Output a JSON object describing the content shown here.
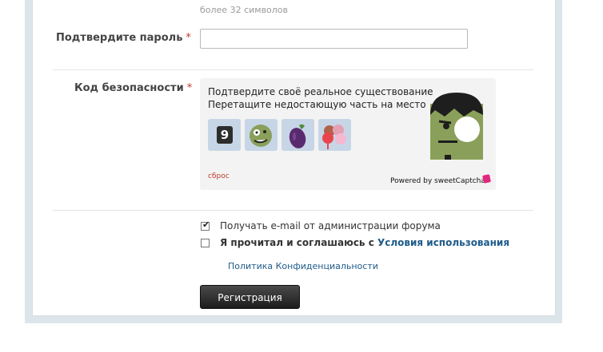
{
  "form": {
    "password_hint": "более 32 символов",
    "confirm_password_label": "Подтвердите пароль",
    "required_mark": "*",
    "security_code_label": "Код безопасности"
  },
  "captcha": {
    "line1": "Подтвердите своё реальное существование",
    "line2": "Перетащите недостающую часть на место",
    "tiles": [
      "number-nine-tile",
      "zombie-face-tile",
      "eggplant-tile",
      "ice-cream-tile"
    ],
    "tile_nine_text": "9",
    "reset_label": "сброс",
    "powered_by": "Powered by sweetCaptcha"
  },
  "options": {
    "email_label": "Получать e-mail от администрации форума",
    "email_checked": true,
    "agree_prefix": "Я прочитал и соглашаюсь с",
    "agree_link": "Условия использования",
    "agree_checked": false,
    "privacy_link": "Политика Конфиденциальности"
  },
  "submit": {
    "label": "Регистрация"
  },
  "colors": {
    "required": "#c0392b",
    "link": "#1e5b8a",
    "tile_bg": "#c7d6e6",
    "button_dark": "#1c1c1c"
  }
}
